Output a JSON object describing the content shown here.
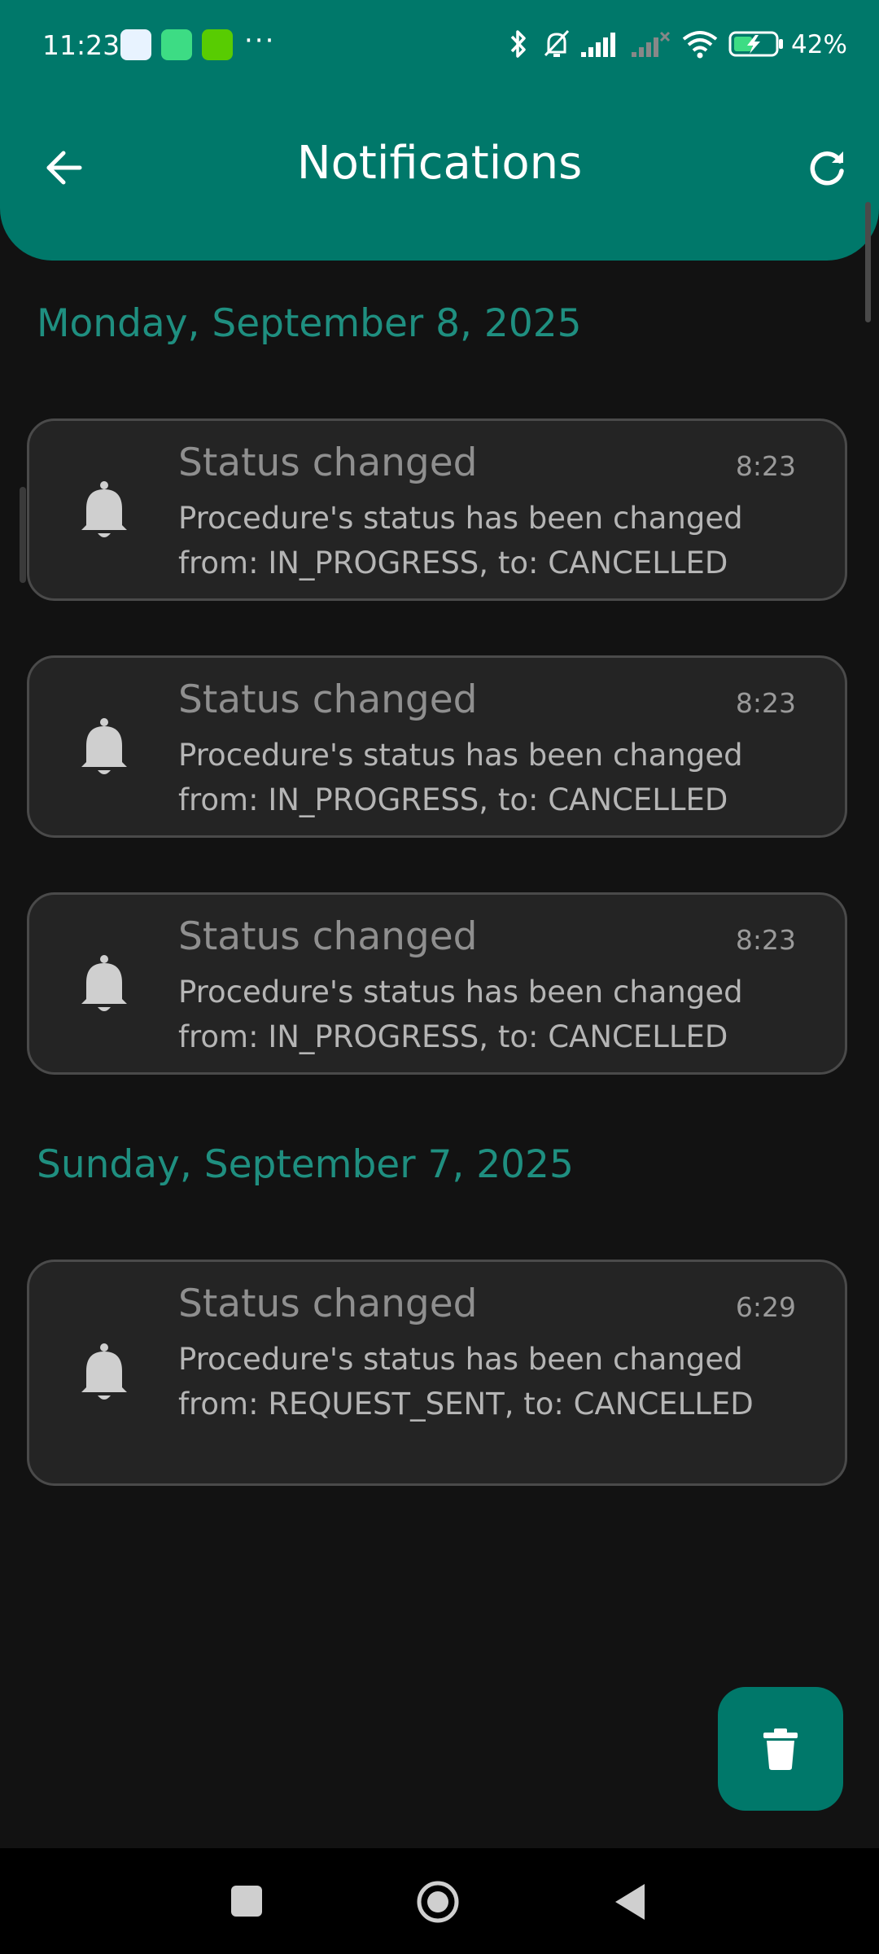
{
  "status_bar": {
    "time": "11:23",
    "more": "···",
    "battery": "42%"
  },
  "app_bar": {
    "title": "Notifications",
    "back_icon": "arrow-back-icon",
    "refresh_icon": "refresh-icon"
  },
  "sections": [
    {
      "date": "Monday, September 8, 2025",
      "items": [
        {
          "title": "Status changed",
          "time": "8:23",
          "body": "Procedure's status has been changed from: IN_PROGRESS, to: CANCELLED"
        },
        {
          "title": "Status changed",
          "time": "8:23",
          "body": "Procedure's status has been changed from: IN_PROGRESS, to: CANCELLED"
        },
        {
          "title": "Status changed",
          "time": "8:23",
          "body": "Procedure's status has been changed from: IN_PROGRESS, to: CANCELLED"
        }
      ]
    },
    {
      "date": "Sunday, September 7, 2025",
      "items": [
        {
          "title": "Status changed",
          "time": "6:29",
          "body": "Procedure's status has been changed from: REQUEST_SENT, to: CANCELLED"
        }
      ]
    }
  ],
  "fab": {
    "icon": "trash-icon"
  },
  "colors": {
    "accent": "#00786A",
    "date": "#1f8f80",
    "background": "#121212",
    "card": "#242424"
  }
}
